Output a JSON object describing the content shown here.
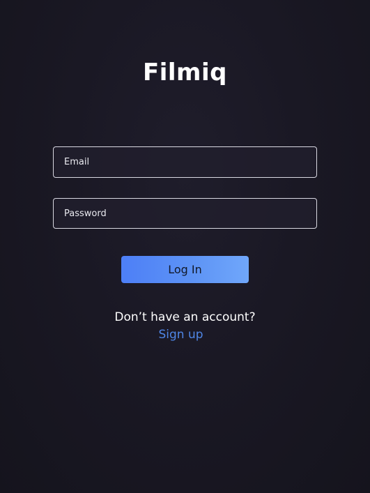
{
  "app": {
    "logo_text": "Filmiq"
  },
  "form": {
    "email": {
      "value": "",
      "placeholder": "Email"
    },
    "password": {
      "value": "",
      "placeholder": "Password"
    },
    "login_label": "Log In"
  },
  "footer": {
    "prompt_text": "Don’t have an account?",
    "signup_label": "Sign up"
  },
  "colors": {
    "background": "#1a1824",
    "button_start": "#4d7ff7",
    "button_end": "#70a7fb",
    "link": "#4f86e6",
    "field_border": "#d9d9e2"
  }
}
